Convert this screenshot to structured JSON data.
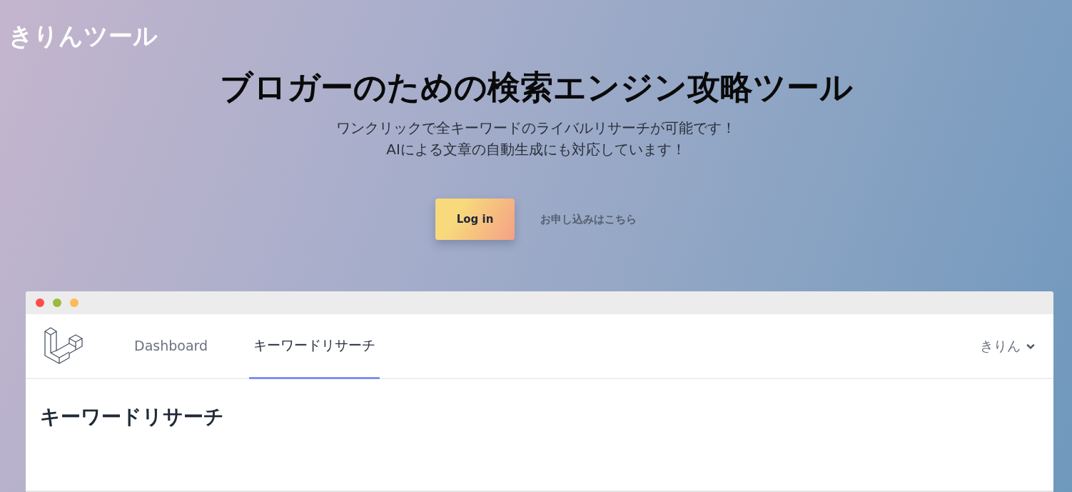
{
  "brand": "きりんツール",
  "hero": {
    "title": "ブロガーのための検索エンジン攻略ツール",
    "subtitle_lines": [
      "ワンクリックで全キーワードのライバルリサーチが可能です！",
      "AIによる文章の自動生成にも対応しています！"
    ],
    "login_button": "Log in",
    "signup_link": "お申し込みはこちら"
  },
  "preview": {
    "window_controls": [
      {
        "color": "#fe4c4c"
      },
      {
        "color": "#9bbb3a"
      },
      {
        "color": "#ffb957"
      }
    ],
    "tabs": [
      {
        "label": "Dashboard",
        "selected": false
      },
      {
        "label": "キーワードリサーチ",
        "selected": true
      }
    ],
    "user_menu": "きりん",
    "page_heading": "キーワードリサーチ"
  }
}
